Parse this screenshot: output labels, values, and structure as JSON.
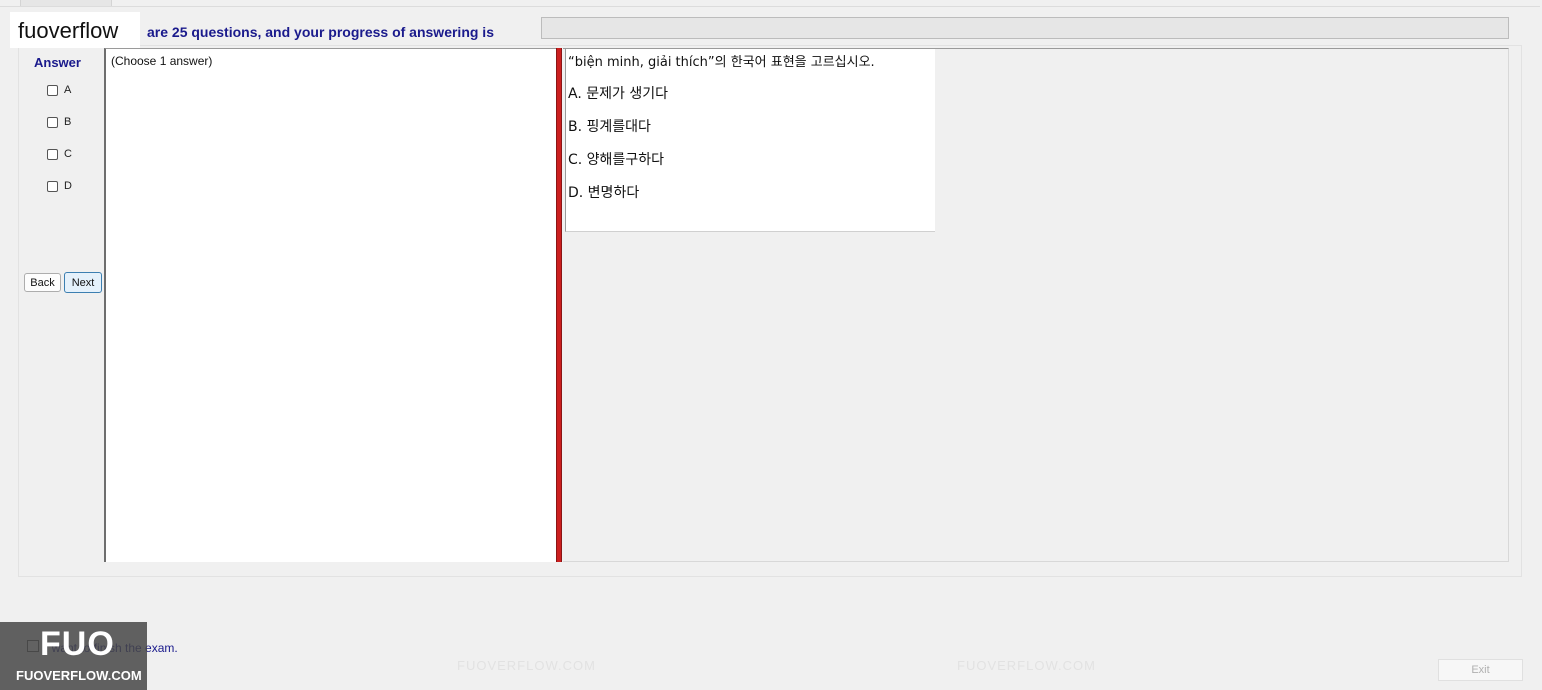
{
  "brand": {
    "logo_text": "fuoverflow",
    "corner_logo_big": "FUO",
    "corner_logo_small": "FUOVERFLOW.COM",
    "watermark_text": "FUOVERFLOW.COM"
  },
  "header": {
    "progress_label": "are 25 questions, and your progress of answering is",
    "progress_fraction": 0
  },
  "answer_panel": {
    "title": "Answer",
    "options": [
      "A",
      "B",
      "C",
      "D"
    ],
    "back_label": "Back",
    "next_label": "Next"
  },
  "left_panel": {
    "choose_text": "(Choose 1 answer)"
  },
  "question": {
    "text": "“biện minh, giải thích”의 한국어 표현을 고르십시오.",
    "options": [
      "A.  문제가 생기다",
      "B.  핑계를대다",
      "C.  양해를구하다",
      "D.  변명하다"
    ]
  },
  "footer": {
    "finish_label": "I want to finish the exam.",
    "exit_label": "Exit"
  },
  "colors": {
    "label_blue": "#1a1a8c",
    "splitter_red": "#cc1f1f"
  }
}
